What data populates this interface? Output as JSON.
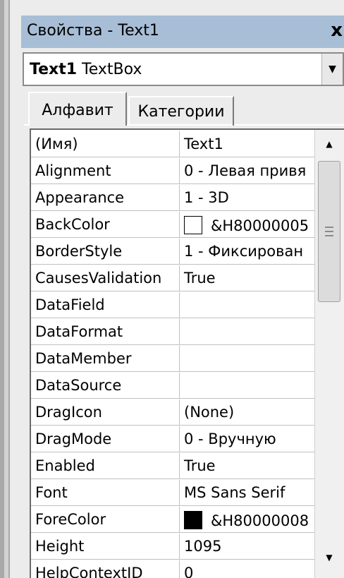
{
  "window": {
    "title": "Свойства - Text1",
    "close_glyph": "x"
  },
  "object_selector": {
    "name": "Text1",
    "type": "TextBox",
    "dropdown_glyph": "▼"
  },
  "tabs": [
    {
      "label": "Алфавит",
      "active": true
    },
    {
      "label": "Категории",
      "active": false
    }
  ],
  "properties": [
    {
      "name": "(Имя)",
      "value": "Text1"
    },
    {
      "name": "Alignment",
      "value": "0 - Левая привя"
    },
    {
      "name": "Appearance",
      "value": "1 - 3D"
    },
    {
      "name": "BackColor",
      "value": "&H80000005",
      "swatch": "#ffffff"
    },
    {
      "name": "BorderStyle",
      "value": "1 - Фиксирован"
    },
    {
      "name": "CausesValidation",
      "value": "True"
    },
    {
      "name": "DataField",
      "value": ""
    },
    {
      "name": "DataFormat",
      "value": ""
    },
    {
      "name": "DataMember",
      "value": ""
    },
    {
      "name": "DataSource",
      "value": ""
    },
    {
      "name": "DragIcon",
      "value": "(None)"
    },
    {
      "name": "DragMode",
      "value": "0 - Вручную"
    },
    {
      "name": "Enabled",
      "value": "True"
    },
    {
      "name": "Font",
      "value": "MS Sans Serif"
    },
    {
      "name": "ForeColor",
      "value": "&H80000008",
      "swatch": "#000000"
    },
    {
      "name": "Height",
      "value": "1095"
    },
    {
      "name": "HelpContextID",
      "value": "0"
    }
  ],
  "scrollbar": {
    "up_glyph": "▲",
    "down_glyph": "▼"
  },
  "colors": {
    "titlebar": "#a7bed6",
    "panel": "#ececec",
    "grid_line": "#c0c0c0"
  }
}
